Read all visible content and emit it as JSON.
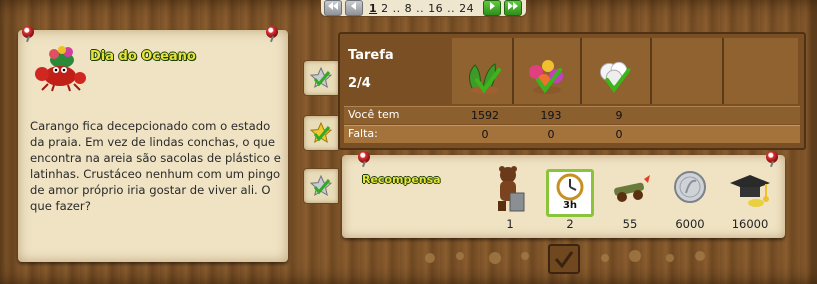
{
  "pagination": {
    "pages_text": "2 .. 8 .. 16 .. 24",
    "current_page": "1",
    "first_icon": "double-left-arrow-icon",
    "prev_icon": "left-arrow-icon",
    "next_icon": "right-arrow-icon",
    "last_icon": "double-right-arrow-icon"
  },
  "quest": {
    "title": "Dia do Oceano",
    "description": "Carango fica decepcionado com o estado da praia. Em vez de lindas conchas, o que encontra na areia são sacolas de plástico e latinhas. Crustáceo nenhum com um pingo de amor próprio iria gostar de viver ali. O que fazer?",
    "icon": "crab-icon"
  },
  "tabs": [
    {
      "icon": "star-silver-checked-icon"
    },
    {
      "icon": "star-gold-checked-icon"
    },
    {
      "icon": "star-silver-checked-icon"
    }
  ],
  "task": {
    "label": "Tarefa",
    "progress": "2/4",
    "have_label": "Você tem",
    "missing_label": "Falta:",
    "items": [
      {
        "icon": "green-seaweed-checked-icon",
        "have": "1592",
        "missing": "0"
      },
      {
        "icon": "coral-checked-icon",
        "have": "193",
        "missing": "0"
      },
      {
        "icon": "white-pearl-checked-icon",
        "have": "9",
        "missing": "0"
      }
    ]
  },
  "reward": {
    "label": "Recompensa",
    "items": [
      {
        "icon": "bear-trash-figure-icon",
        "value": "1"
      },
      {
        "icon": "clock-3h-icon",
        "badge": "3h",
        "value": "2"
      },
      {
        "icon": "cannon-icon",
        "value": "55"
      },
      {
        "icon": "silver-coin-icon",
        "value": "6000"
      },
      {
        "icon": "graduation-cap-icon",
        "value": "16000"
      }
    ]
  },
  "colors": {
    "title_yellow": "#e7e33a",
    "parchment": "#efe3c4",
    "wood": "#7b4f24",
    "check_green": "#3cb51c"
  }
}
